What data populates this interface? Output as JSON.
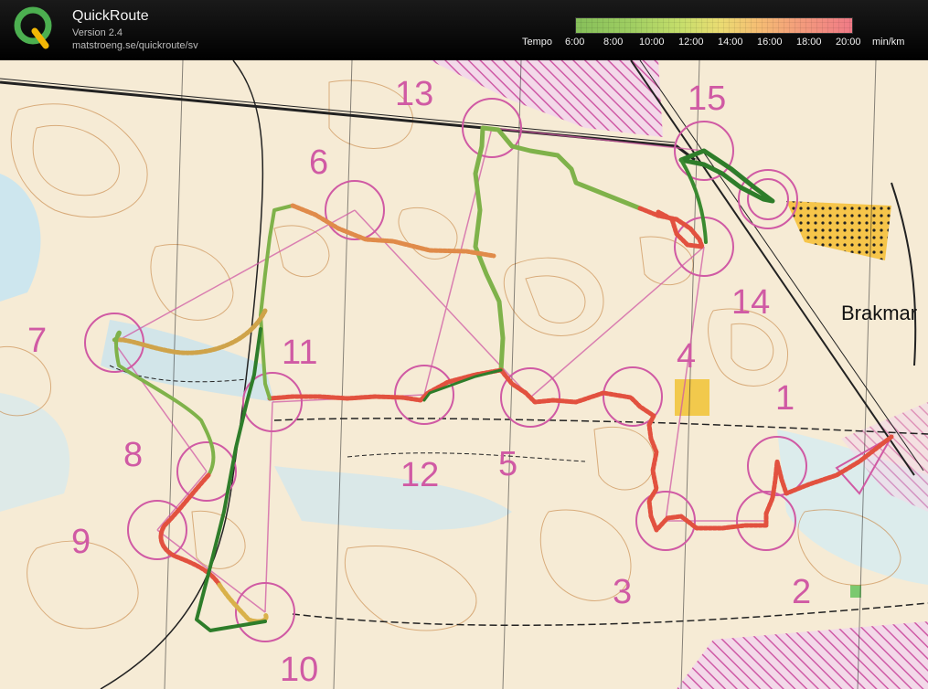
{
  "app": {
    "title": "QuickRoute",
    "version": "Version 2.4",
    "url": "matstroeng.se/quickroute/sv"
  },
  "tempo_scale": {
    "label": "Tempo",
    "ticks": [
      "6:00",
      "8:00",
      "10:00",
      "12:00",
      "14:00",
      "16:00",
      "18:00",
      "20:00"
    ],
    "unit": "min/km",
    "colors": [
      "#86bf5a",
      "#c6de6b",
      "#eadc72",
      "#f5bd73",
      "#f07a86"
    ]
  },
  "map": {
    "place_name": "Brakmar",
    "control_numbers": [
      "1",
      "2",
      "3",
      "4",
      "5",
      "6",
      "7",
      "8",
      "9",
      "10",
      "11",
      "12",
      "13",
      "14",
      "15"
    ],
    "colors": {
      "control": "#d05aa4",
      "route_slow": "#e24a3a",
      "route_fast": "#2e7d2a",
      "water": "#bfe1ec",
      "open_land": "#f2c94c"
    }
  }
}
